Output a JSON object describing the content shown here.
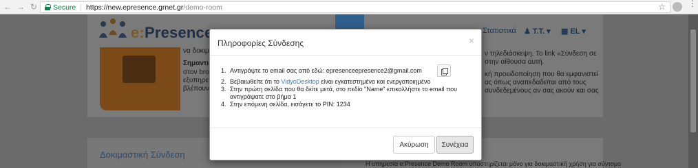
{
  "browser": {
    "secure_label": "Secure",
    "url_host": "https://new.epresence.grnet.gr",
    "url_path": "/demo-room"
  },
  "header": {
    "logo_e": "e:",
    "logo_rest": "Presence",
    "nav_stats": "Στατιστικά",
    "nav_user": "T.T.",
    "nav_lang": "EL"
  },
  "background": {
    "left_line1": "να δοκιμ",
    "left_bold": "Σημαντι",
    "left_line3": "στον bro",
    "left_line4": "εξυπηρετ",
    "left_line5": "βλέπουν",
    "right_line1": "ν τηλεδιάσκεψη. Το link «Σύνδεση σε",
    "right_line2": "στην αίθουσα αυτή.",
    "right_line3": "κή προειδοποίηση που θα εμφανιστεί",
    "right_line4": "ας όπως αναπεδαδεϊται από τους",
    "right_line5": "συνδεδεμένους αν σας ακούν και σας",
    "bottom_title": "Δοκιμαστική Σύνδεση",
    "bottom_text": "Η υπηρεσία e:Presence Demo Room υποστηρίζεται μόνο για δοκιμαστική χρήση για σύντομο"
  },
  "modal": {
    "title": "Πληροφορίες Σύνδεσης",
    "close": "×",
    "step1": "Αντιγράψτε το email σας από εδώ: epresenceepresence2@gmail.com",
    "step2_pre": "Βεβαιωθείτε ότι το ",
    "step2_link": "VidyoDesktop",
    "step2_post": " είναι εγκατεστημένο και ενεργοποιημένο",
    "step3": "Στην πρώτη σελίδα που θα δείτε μετά, στο πεδίο \"Name\" επικολλήστε το email που αντιγράψατε στο βήμα 1",
    "step4": "Στην επόμενη σελίδα, εισάγετε το PIN: 1234",
    "num1": "1.",
    "num2": "2.",
    "num3": "3.",
    "num4": "4.",
    "cancel_label": "Ακύρωση",
    "continue_label": "Συνέχεια"
  }
}
